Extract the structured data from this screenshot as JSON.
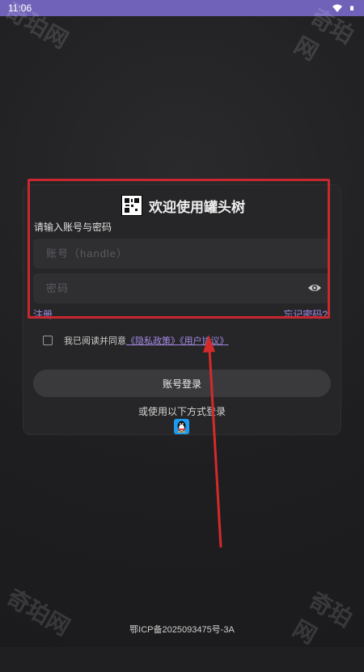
{
  "status": {
    "time": "11:06"
  },
  "app": {
    "title": "欢迎使用罐头树"
  },
  "login": {
    "subtitle": "请输入账号与密码",
    "account_placeholder": "账号（handle）",
    "password_placeholder": "密码",
    "register": "注册",
    "forgot": "忘记密码?",
    "agree_prefix": "我已阅读并同意",
    "privacy_link": "《隐私政策》",
    "user_link": "《用户协议》",
    "login_button": "账号登录",
    "other_methods": "或使用以下方式登录",
    "qq_icon": "qq-penguin-icon"
  },
  "footer": {
    "icp": "鄂ICP备2025093475号-3A"
  },
  "watermarks": [
    "奇珀网",
    "奇珀网",
    "奇珀网",
    "奇珀网"
  ],
  "colors": {
    "status_bar": "#6f62b8",
    "accent_link": "#a48ae6",
    "highlight": "#c7282f",
    "arrow": "#d42a2a"
  }
}
